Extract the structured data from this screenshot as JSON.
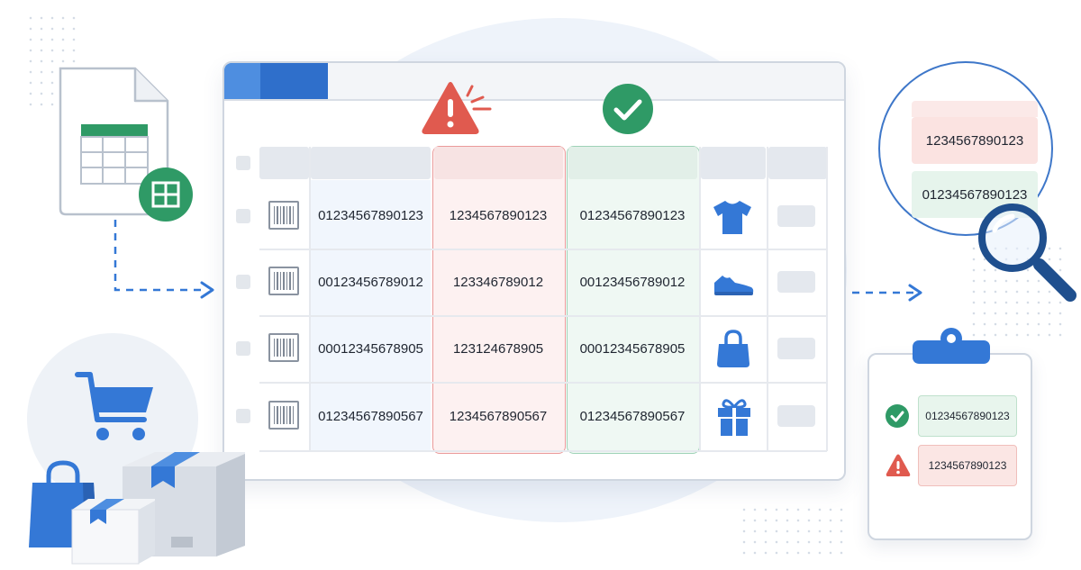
{
  "colors": {
    "accent_blue": "#3478d6",
    "mismatch_red": "#e05a4f",
    "match_green": "#2f9a66"
  },
  "spreadsheet_file": {
    "icon": "spreadsheet-file-icon",
    "badge_icon": "table-icon"
  },
  "table": {
    "rows": [
      {
        "source": "01234567890123",
        "mismatch": "1234567890123",
        "match": "01234567890123",
        "product_icon": "tshirt-icon"
      },
      {
        "source": "00123456789012",
        "mismatch": "123346789012",
        "match": "00123456789012",
        "product_icon": "sneaker-icon"
      },
      {
        "source": "00012345678905",
        "mismatch": "123124678905",
        "match": "00012345678905",
        "product_icon": "handbag-icon"
      },
      {
        "source": "01234567890567",
        "mismatch": "1234567890567",
        "match": "01234567890567",
        "product_icon": "gift-box-icon"
      }
    ],
    "mismatch_icon": "warning-icon",
    "match_icon": "check-icon"
  },
  "magnifier": {
    "mismatch_value": "1234567890123",
    "match_value": "01234567890123"
  },
  "clipboard": {
    "items": [
      {
        "status": "valid",
        "value": "01234567890123"
      },
      {
        "status": "invalid",
        "value": "1234567890123"
      }
    ]
  }
}
